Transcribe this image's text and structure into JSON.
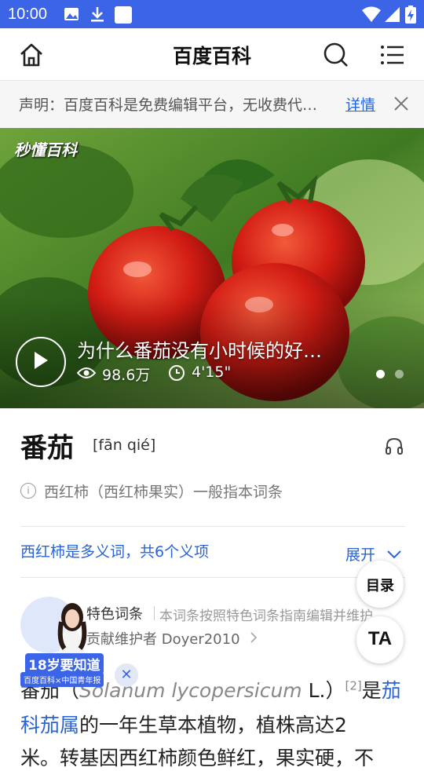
{
  "status_bar": {
    "time": "10:00"
  },
  "app_bar": {
    "title": "百度百科"
  },
  "notice": {
    "text": "声明：百度百科是免费编辑平台，无收费代…",
    "link": "详情"
  },
  "video": {
    "logo": "秒懂百科",
    "title": "为什么番茄没有小时候的好…",
    "views": "98.6万",
    "duration": "4'15\"",
    "slide_count": 2,
    "active_slide": 1
  },
  "entry": {
    "title": "番茄",
    "pinyin": "[fān qié]",
    "note": "西红柿（西红柿果实）一般指本词条",
    "polysemy": "西红柿是多义词，共6个义项",
    "expand": "展开"
  },
  "fabs": {
    "toc": "目录",
    "ta": "TA"
  },
  "featured": {
    "label": "特色词条",
    "desc": "本词条按照特色词条指南编辑并维护",
    "maintainer": "贡献维护者 Doyer2010"
  },
  "body": {
    "line1_prefix": "番茄（",
    "latin": "Solanum lycopersicum",
    "line1_mid": " L.）",
    "ref": "[2]",
    "line1_after": "是",
    "genus_link_1": "茄",
    "genus_link_2": "科茄属",
    "line2_rest": "的一年生草本植物，植株高达2",
    "line3": "米。转基因西红柿颜色鲜红，果实硬，不"
  },
  "promo": {
    "badge": "18岁要知道",
    "sub": "百度百科×中国青年报"
  }
}
